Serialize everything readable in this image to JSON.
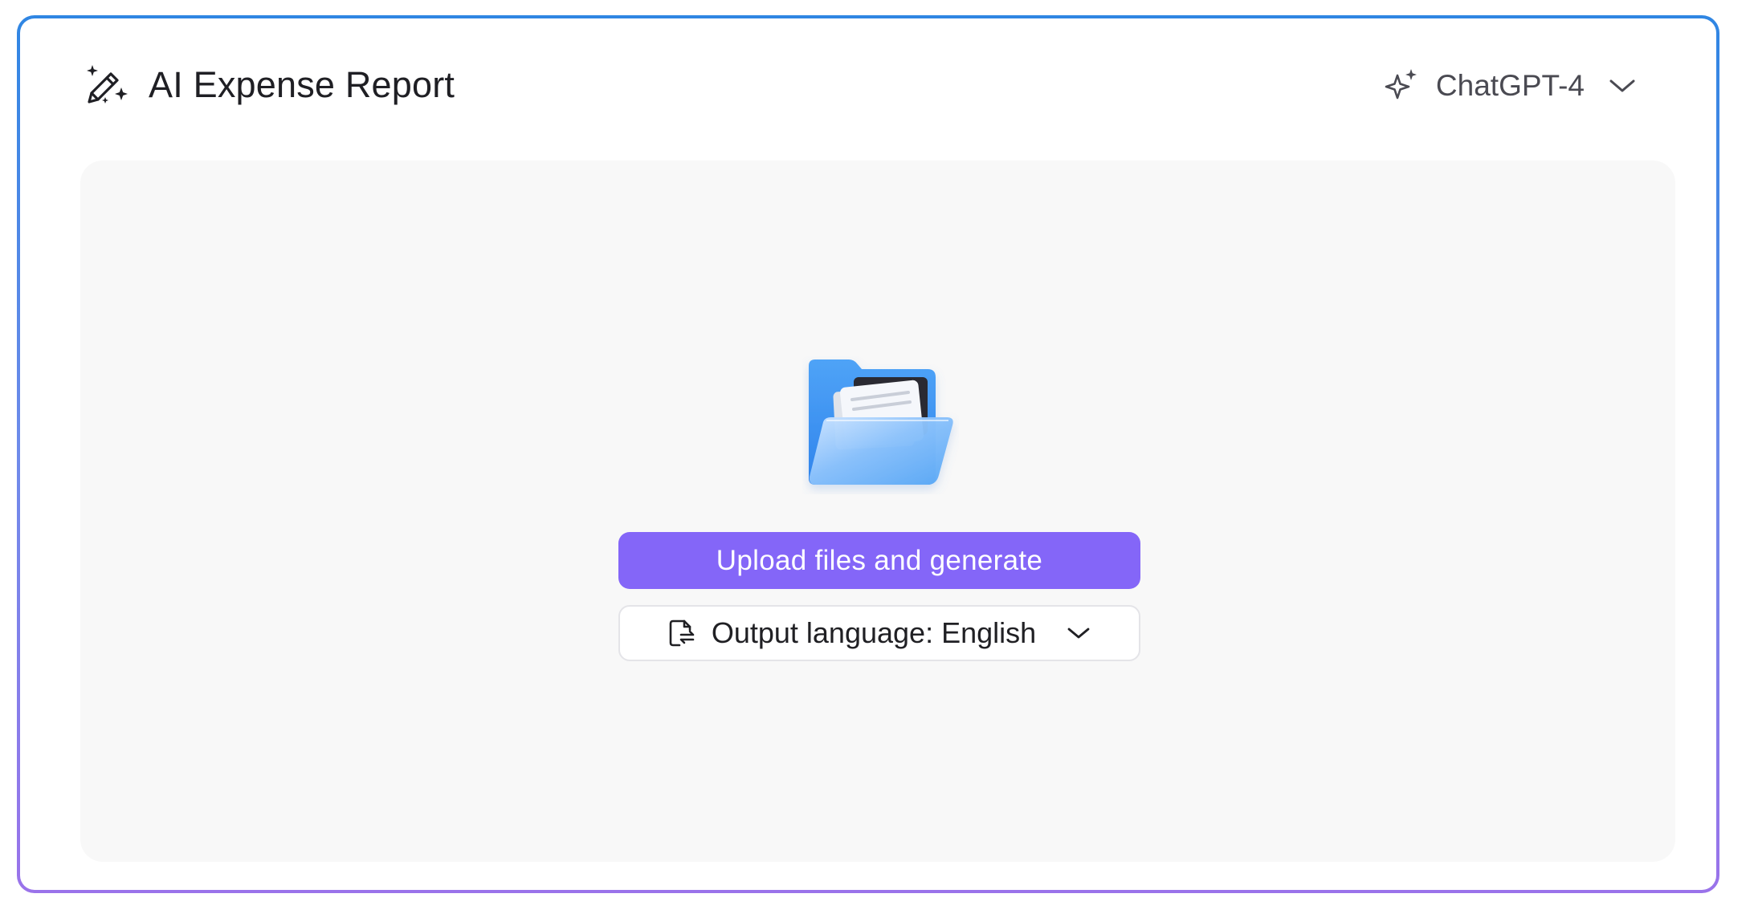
{
  "header": {
    "title": "AI Expense Report",
    "title_icon": "magic-pencil-icon"
  },
  "model_selector": {
    "icon": "sparkle-icon",
    "selected": "ChatGPT-4",
    "chevron": "chevron-down-icon"
  },
  "upload": {
    "illustration": "folder-icon",
    "button_label": "Upload files and generate"
  },
  "language_selector": {
    "icon": "document-translate-icon",
    "label": "Output language: English",
    "chevron": "chevron-down-icon"
  },
  "colors": {
    "accent": "#8466f8",
    "frame_top": "#2f86e3",
    "frame_bottom": "#9a73ea",
    "drop_zone_bg": "#f8f8f8"
  }
}
